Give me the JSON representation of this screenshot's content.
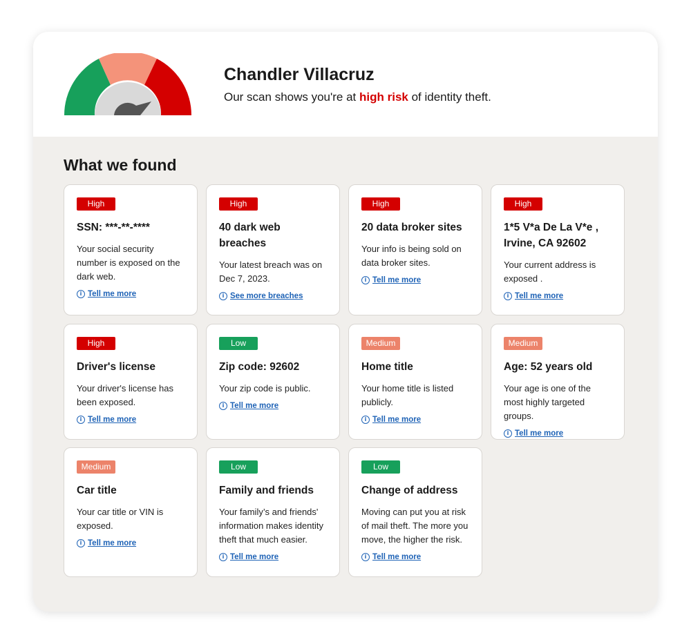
{
  "colors": {
    "high": "#d40000",
    "low": "#17a05b",
    "medium": "#ec836a",
    "link": "#1f63b6",
    "panel_bg": "#f1efec",
    "gauge_green": "#17a05b",
    "gauge_salmon": "#f4937a",
    "gauge_red": "#d40000",
    "gauge_center": "#d9d9d9",
    "needle": "#545454"
  },
  "gauge": {
    "risk_level": "high"
  },
  "header": {
    "name": "Chandler Villacruz",
    "summary_prefix": "Our scan shows you're at ",
    "summary_risk": "high risk",
    "summary_suffix": " of identity theft."
  },
  "section": {
    "title": "What we found"
  },
  "icons": {
    "info": "info-circle-icon"
  },
  "cards": [
    {
      "badge": "High",
      "level": "high",
      "title": "SSN: ***-**-****",
      "desc": "Your social security number is exposed on the dark web.",
      "link": "Tell me more"
    },
    {
      "badge": "High",
      "level": "high",
      "title": "40 dark web breaches",
      "desc": "Your latest breach was on Dec 7, 2023.",
      "link": "See more breaches"
    },
    {
      "badge": "High",
      "level": "high",
      "title": "20 data broker sites",
      "desc": "Your info is  being sold on data broker sites.",
      "link": "Tell me more"
    },
    {
      "badge": "High",
      "level": "high",
      "title": "1*5 V*a De La V*e , Irvine, CA 92602",
      "desc": "Your current address is exposed .",
      "link": "Tell me more"
    },
    {
      "badge": "High",
      "level": "high",
      "title": "Driver's license",
      "desc": "Your driver's license has been exposed.",
      "link": "Tell me more"
    },
    {
      "badge": "Low",
      "level": "low",
      "title": "Zip code: 92602",
      "desc": "Your zip code is public.",
      "link": "Tell me more"
    },
    {
      "badge": "Medium",
      "level": "medium",
      "title": "Home title",
      "desc": "Your home title is listed publicly.",
      "link": "Tell me more"
    },
    {
      "badge": "Medium",
      "level": "medium",
      "title": "Age: 52 years old",
      "desc": "Your age is one of the most highly targeted groups.",
      "link": "Tell me more"
    },
    {
      "badge": "Medium",
      "level": "medium",
      "title": "Car title",
      "desc": "Your car title or VIN is exposed.",
      "link": "Tell me more"
    },
    {
      "badge": "Low",
      "level": "low",
      "title": "Family and friends",
      "desc": "Your family’s and friends' information makes identity theft that much easier.",
      "link": "Tell me more"
    },
    {
      "badge": "Low",
      "level": "low",
      "title": "Change of address",
      "desc": "Moving can put you at risk of mail theft. The more you move, the higher the risk.",
      "link": "Tell me more"
    }
  ]
}
